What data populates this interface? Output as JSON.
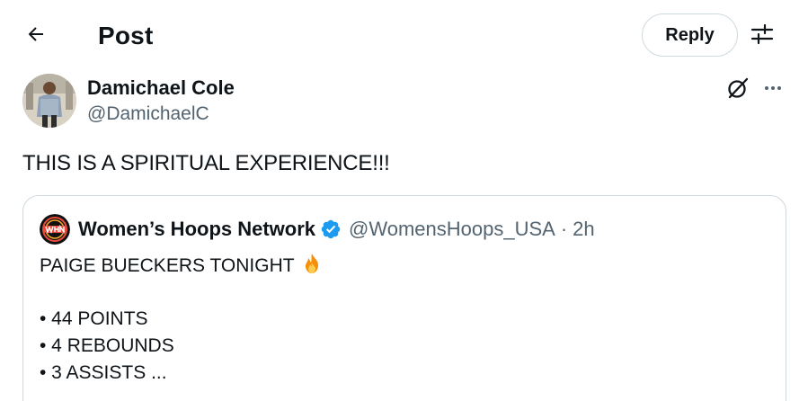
{
  "header": {
    "title": "Post",
    "reply_label": "Reply",
    "back_icon": "arrow-left-icon",
    "settings_icon": "sliders-icon"
  },
  "tweet": {
    "author_name": "Damichael Cole",
    "author_handle": "@DamichaelC",
    "text": "THIS IS A SPIRITUAL EXPERIENCE!!!",
    "grok_icon": "grok-icon",
    "more_icon": "more-icon"
  },
  "quote": {
    "name": "Women’s Hoops Network",
    "handle": "@WomensHoops_USA",
    "separator": "·",
    "time": "2h",
    "verified_color": "#1d9bf0",
    "lines": [
      "PAIGE BUECKERS TONIGHT",
      "",
      "• 44 POINTS",
      "• 4 REBOUNDS",
      "• 3 ASSISTS ..."
    ]
  },
  "colors": {
    "text": "#0f1419",
    "secondary": "#536471",
    "border": "#cfd9de",
    "accent": "#1d9bf0"
  }
}
